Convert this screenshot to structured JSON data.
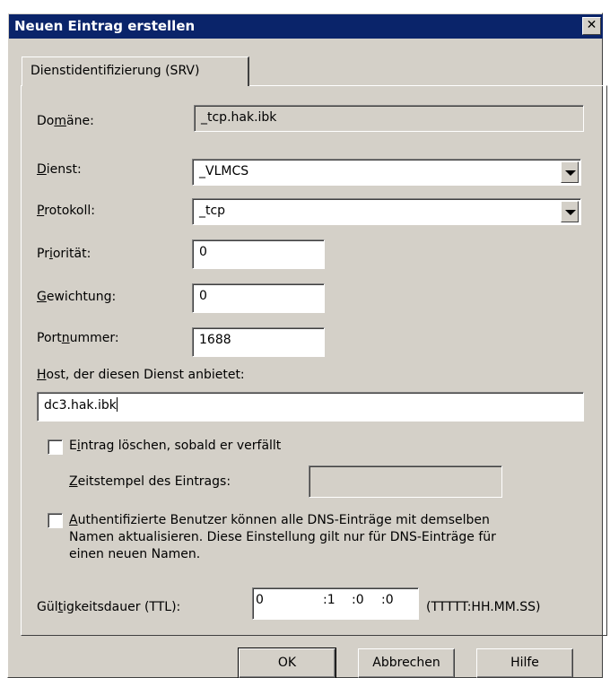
{
  "window": {
    "title": "Neuen Eintrag erstellen",
    "close_glyph": "✕"
  },
  "tab": {
    "label": "Dienstidentifizierung (SRV)"
  },
  "domain": {
    "label_pre": "Do",
    "label_acc": "m",
    "label_post": "äne:",
    "value": "_tcp.hak.ibk"
  },
  "service": {
    "label_pre": "",
    "label_acc": "D",
    "label_post": "ienst:",
    "value": "_VLMCS"
  },
  "protocol": {
    "label_pre": "",
    "label_acc": "P",
    "label_post": "rotokoll:",
    "value": "_tcp"
  },
  "priority": {
    "label_pre": "Pr",
    "label_acc": "i",
    "label_post": "orität:",
    "value": "0"
  },
  "weight": {
    "label_pre": "",
    "label_acc": "G",
    "label_post": "ewichtung:",
    "value": "0"
  },
  "port": {
    "label_pre": "Port",
    "label_acc": "n",
    "label_post": "ummer:",
    "value": "1688"
  },
  "host": {
    "label_pre": "",
    "label_acc": "H",
    "label_post": "ost, der diesen Dienst anbietet:",
    "value": "dc3.hak.ibk"
  },
  "delete_when_stale": {
    "label_pre": "E",
    "label_acc": "i",
    "label_post": "ntrag löschen, sobald er verfällt",
    "checked": false
  },
  "timestamp": {
    "label_pre": "",
    "label_acc": "Z",
    "label_post": "eitstempel des Eintrags:",
    "value": ""
  },
  "auth_users": {
    "label_acc": "A",
    "line1_post": "uthentifizierte Benutzer können alle DNS-Einträge mit demselben",
    "line2": "Namen aktualisieren. Diese Einstellung gilt nur für DNS-Einträge für",
    "line3": "einen neuen Namen.",
    "checked": false
  },
  "ttl": {
    "label_pre": "Gül",
    "label_acc": "t",
    "label_post": "igkeitsdauer (TTL):",
    "days": "0",
    "hours": ":1",
    "minutes": ":0",
    "seconds": ":0",
    "format_hint": "(TTTTT:HH.MM.SS)"
  },
  "buttons": {
    "ok": "OK",
    "cancel": "Abbrechen",
    "help": "Hilfe"
  },
  "colors": {
    "titlebar": "#0a246a",
    "face": "#d4d0c8"
  }
}
